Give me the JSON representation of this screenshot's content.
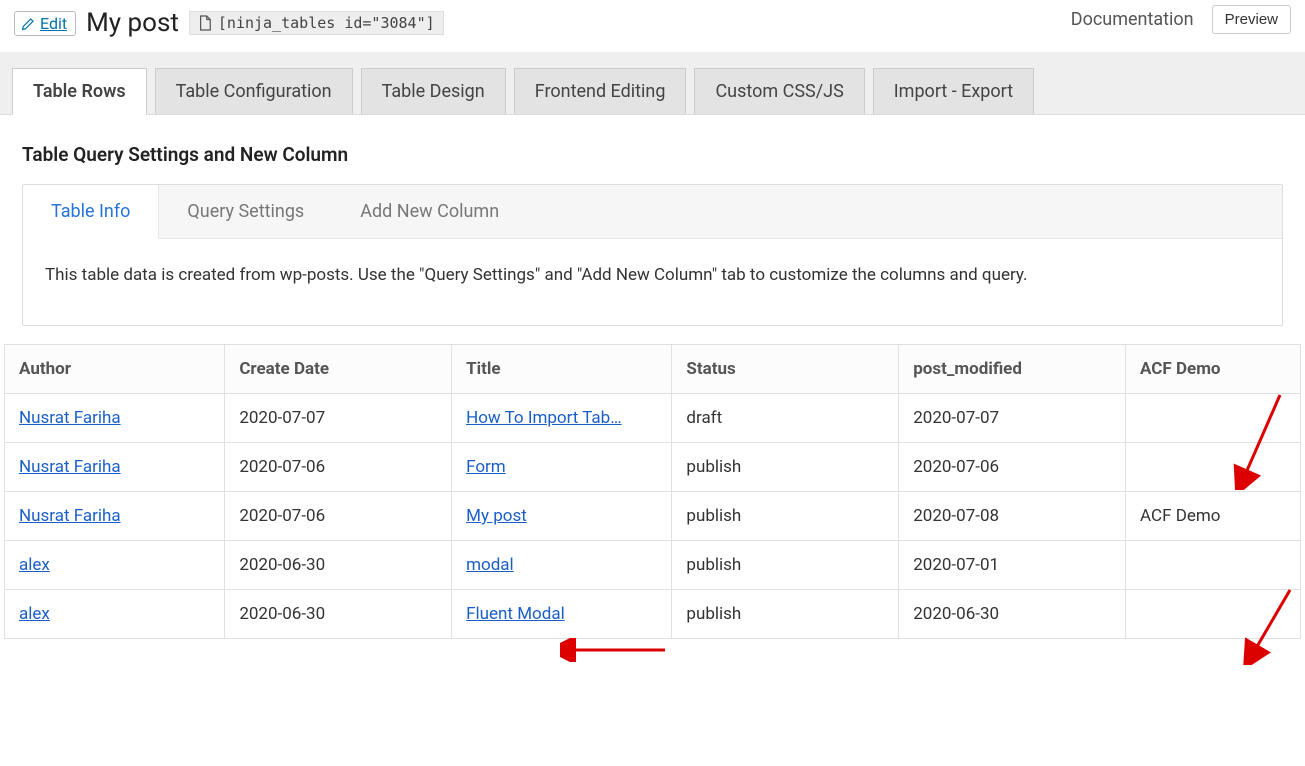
{
  "header": {
    "edit_label": "Edit",
    "title": "My post",
    "shortcode": "[ninja_tables id=\"3084\"]",
    "documentation_label": "Documentation",
    "preview_label": "Preview"
  },
  "main_tabs": [
    "Table Rows",
    "Table Configuration",
    "Table Design",
    "Frontend Editing",
    "Custom CSS/JS",
    "Import - Export"
  ],
  "section_title": "Table Query Settings and New Column",
  "sub_tabs": [
    "Table Info",
    "Query Settings",
    "Add New Column"
  ],
  "info_text": "This table data is created from wp-posts. Use the \"Query Settings\" and \"Add New Column\" tab to customize the columns and query.",
  "table": {
    "columns": [
      "Author",
      "Create Date",
      "Title",
      "Status",
      "post_modified",
      "ACF Demo"
    ],
    "rows": [
      {
        "author": "Nusrat Fariha",
        "create_date": "2020-07-07",
        "title": "How To Import Tab…",
        "status": "draft",
        "post_modified": "2020-07-07",
        "acf_demo": ""
      },
      {
        "author": "Nusrat Fariha",
        "create_date": "2020-07-06",
        "title": "Form",
        "status": "publish",
        "post_modified": "2020-07-06",
        "acf_demo": ""
      },
      {
        "author": "Nusrat Fariha",
        "create_date": "2020-07-06",
        "title": "My post",
        "status": "publish",
        "post_modified": "2020-07-08",
        "acf_demo": "ACF Demo"
      },
      {
        "author": "alex",
        "create_date": "2020-06-30",
        "title": "modal",
        "status": "publish",
        "post_modified": "2020-07-01",
        "acf_demo": ""
      },
      {
        "author": "alex",
        "create_date": "2020-06-30",
        "title": "Fluent Modal",
        "status": "publish",
        "post_modified": "2020-06-30",
        "acf_demo": ""
      }
    ]
  }
}
